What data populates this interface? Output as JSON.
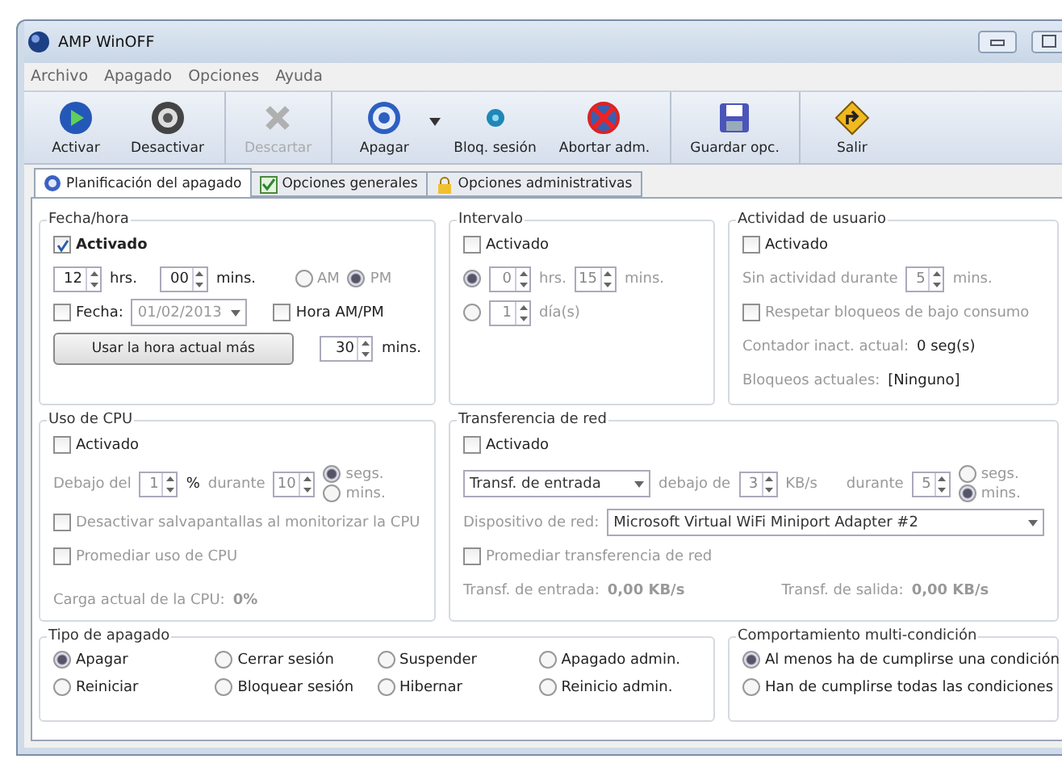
{
  "window": {
    "title": "AMP WinOFF"
  },
  "menu": [
    "Archivo",
    "Apagado",
    "Opciones",
    "Ayuda"
  ],
  "toolbar": [
    [
      {
        "label": "Activar",
        "kind": "activate",
        "disabled": false
      },
      {
        "label": "Desactivar",
        "kind": "deactivate",
        "disabled": false
      }
    ],
    [
      {
        "label": "Descartar",
        "kind": "discard",
        "disabled": true
      }
    ],
    [
      {
        "label": "Apagar",
        "kind": "power",
        "disabled": false,
        "dropdown": true
      },
      {
        "label": "Bloq. sesión",
        "kind": "lock",
        "disabled": false
      },
      {
        "label": "Abortar adm.",
        "kind": "abort",
        "disabled": false
      }
    ],
    [
      {
        "label": "Guardar opc.",
        "kind": "save",
        "disabled": false
      }
    ],
    [
      {
        "label": "Salir",
        "kind": "exit",
        "disabled": false
      }
    ]
  ],
  "tabs": [
    {
      "label": "Planificación del apagado",
      "kind": "schedule",
      "selected": true
    },
    {
      "label": "Opciones generales",
      "kind": "general",
      "selected": false
    },
    {
      "label": "Opciones administrativas",
      "kind": "admin",
      "selected": false
    }
  ],
  "fecha_hora": {
    "title": "Fecha/hora",
    "enabled": {
      "label": "Activado",
      "checked": true
    },
    "hours": {
      "value": "12",
      "unit": "hrs."
    },
    "minutes": {
      "value": "00",
      "unit": "mins."
    },
    "ampm": [
      {
        "label": "AM",
        "selected": false
      },
      {
        "label": "PM",
        "selected": true
      }
    ],
    "date": {
      "label": "Fecha:",
      "checked": false,
      "value": "01/02/2013"
    },
    "ampm_toggle": {
      "label": "Hora AM/PM",
      "checked": false
    },
    "button": "Usar la hora actual más",
    "offset": {
      "value": "30",
      "unit": "mins."
    }
  },
  "intervalo": {
    "title": "Intervalo",
    "enabled": {
      "label": "Activado",
      "checked": false
    },
    "options": [
      {
        "selected": true,
        "fields": [
          {
            "value": "0",
            "unit": "hrs."
          },
          {
            "value": "15",
            "unit": "mins."
          }
        ]
      },
      {
        "selected": false,
        "fields": [
          {
            "value": "1",
            "unit": "día(s)"
          }
        ]
      }
    ]
  },
  "actividad": {
    "title": "Actividad de usuario",
    "enabled": {
      "label": "Activado",
      "checked": false
    },
    "idle": {
      "label": "Sin actividad durante",
      "value": "5",
      "unit": "mins."
    },
    "respect": {
      "label": "Respetar bloqueos de bajo consumo",
      "checked": false
    },
    "counter": {
      "label": "Contador inact. actual:",
      "value": "0 seg(s)"
    },
    "locks": {
      "label": "Bloqueos actuales:",
      "value": "[Ninguno]"
    }
  },
  "cpu": {
    "title": "Uso de CPU",
    "enabled": {
      "label": "Activado",
      "checked": false
    },
    "below": "Debajo del",
    "value": "1",
    "unit": "%",
    "during": "durante",
    "time": "10",
    "units": [
      {
        "label": "segs.",
        "selected": true
      },
      {
        "label": "mins.",
        "selected": false
      }
    ],
    "options": [
      {
        "label": "Desactivar salvapantallas al monitorizar la CPU",
        "checked": false
      },
      {
        "label": "Promediar uso de CPU",
        "checked": false
      }
    ],
    "load": {
      "label": "Carga actual de la CPU:",
      "value": "0%"
    }
  },
  "red": {
    "title": "Transferencia de red",
    "enabled": {
      "label": "Activado",
      "checked": false
    },
    "direction": "Transf. de entrada",
    "below": "debajo de",
    "value": "3",
    "unit": "KB/s",
    "during": "durante",
    "time": "5",
    "units": [
      {
        "label": "segs.",
        "selected": false
      },
      {
        "label": "mins.",
        "selected": true
      }
    ],
    "device": {
      "label": "Dispositivo de red:",
      "value": "Microsoft Virtual WiFi Miniport Adapter #2"
    },
    "average": {
      "label": "Promediar transferencia de red",
      "checked": false
    },
    "in": {
      "label": "Transf. de entrada:",
      "value": "0,00 KB/s"
    },
    "out": {
      "label": "Transf. de salida:",
      "value": "0,00 KB/s"
    }
  },
  "tipo": {
    "title": "Tipo de apagado",
    "options": [
      {
        "label": "Apagar",
        "selected": true
      },
      {
        "label": "Cerrar sesión",
        "selected": false
      },
      {
        "label": "Suspender",
        "selected": false
      },
      {
        "label": "Apagado admin.",
        "selected": false
      },
      {
        "label": "Reiniciar",
        "selected": false
      },
      {
        "label": "Bloquear sesión",
        "selected": false
      },
      {
        "label": "Hibernar",
        "selected": false
      },
      {
        "label": "Reinicio admin.",
        "selected": false
      }
    ]
  },
  "comportamiento": {
    "title": "Comportamiento multi-condición",
    "options": [
      {
        "label": "Al menos ha de cumplirse una condición",
        "selected": true
      },
      {
        "label": "Han de cumplirse todas las condiciones",
        "selected": false
      }
    ]
  }
}
